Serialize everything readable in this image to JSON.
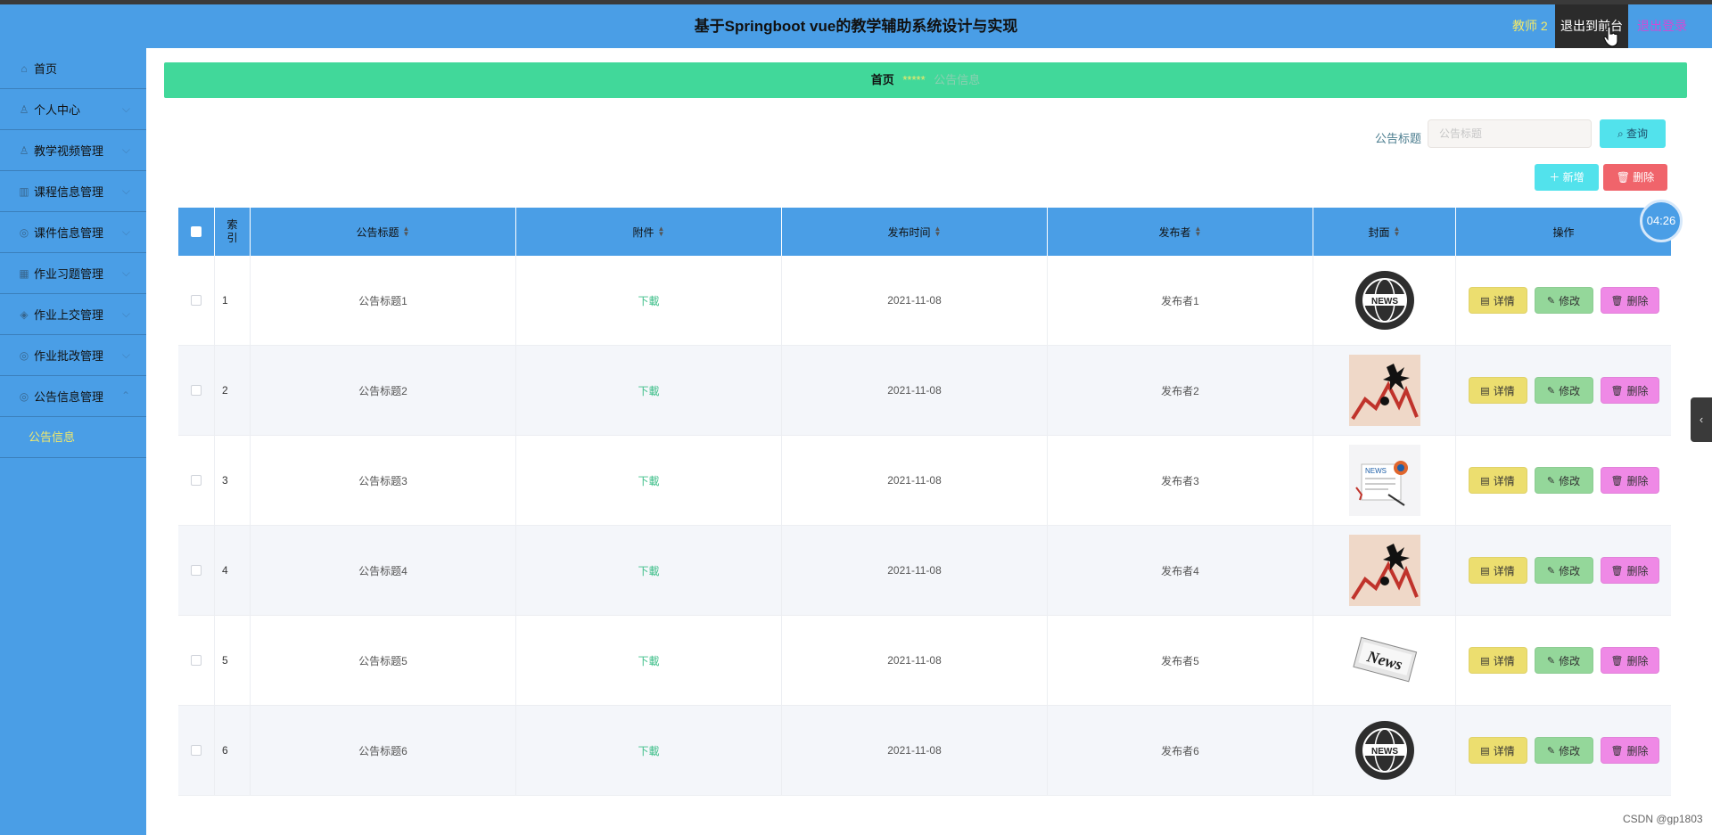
{
  "header": {
    "title": "基于Springboot vue的教学辅助系统设计与实现",
    "user": "教师 2",
    "front_label": "退出到前台",
    "logout_label": "退出登录"
  },
  "sidebar": {
    "items": [
      {
        "label": "首页",
        "icon": "home-icon"
      },
      {
        "label": "个人中心",
        "icon": "user-icon"
      },
      {
        "label": "教学视频管理",
        "icon": "video-icon"
      },
      {
        "label": "课程信息管理",
        "icon": "course-icon"
      },
      {
        "label": "课件信息管理",
        "icon": "courseware-icon"
      },
      {
        "label": "作业习题管理",
        "icon": "exercise-icon"
      },
      {
        "label": "作业上交管理",
        "icon": "submit-icon"
      },
      {
        "label": "作业批改管理",
        "icon": "grading-icon"
      },
      {
        "label": "公告信息管理",
        "icon": "notice-icon"
      }
    ],
    "submenu": {
      "label": "公告信息"
    }
  },
  "breadcrumb": {
    "home": "首页",
    "separator": "*****",
    "current": "公告信息"
  },
  "search": {
    "label": "公告标题",
    "placeholder": "公告标题",
    "button": "查询"
  },
  "toolbar": {
    "add": "新增",
    "delete": "删除"
  },
  "table": {
    "headers": [
      "索引",
      "公告标题",
      "附件",
      "发布时间",
      "发布者",
      "封面",
      "操作"
    ],
    "ops": {
      "detail": "详情",
      "edit": "修改",
      "remove": "删除"
    },
    "rows": [
      {
        "index": "1",
        "title": "公告标题1",
        "attachment": "下載",
        "time": "2021-11-08",
        "publisher": "发布者1",
        "cover": "news-globe"
      },
      {
        "index": "2",
        "title": "公告标题2",
        "attachment": "下載",
        "time": "2021-11-08",
        "publisher": "发布者2",
        "cover": "crash-chart"
      },
      {
        "index": "3",
        "title": "公告标题3",
        "attachment": "下載",
        "time": "2021-11-08",
        "publisher": "发布者3",
        "cover": "news-paper"
      },
      {
        "index": "4",
        "title": "公告标题4",
        "attachment": "下載",
        "time": "2021-11-08",
        "publisher": "发布者4",
        "cover": "crash-chart"
      },
      {
        "index": "5",
        "title": "公告标题5",
        "attachment": "下載",
        "time": "2021-11-08",
        "publisher": "发布者5",
        "cover": "news-stamp"
      },
      {
        "index": "6",
        "title": "公告标题6",
        "attachment": "下載",
        "time": "2021-11-08",
        "publisher": "发布者6",
        "cover": "news-globe"
      }
    ]
  },
  "timer": "04:26",
  "watermark": "CSDN @gp1803",
  "colors": {
    "header": "#4a9ee6",
    "breadcrumb": "#41d89a",
    "accent_yellow": "#f2e96a",
    "logout": "#d04bd6"
  }
}
